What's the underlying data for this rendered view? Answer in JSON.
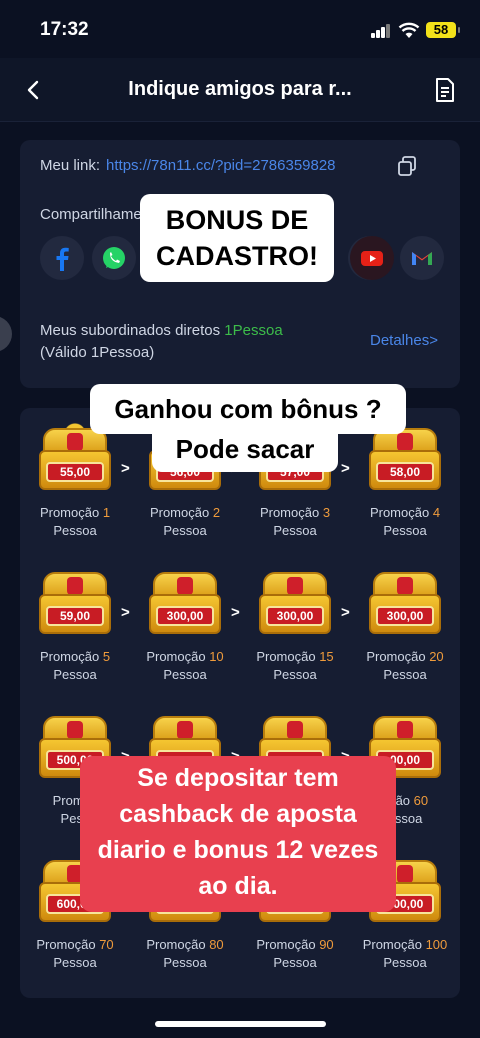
{
  "status_bar": {
    "time": "17:32",
    "battery": "58"
  },
  "header": {
    "title": "Indique amigos para r..."
  },
  "link_card": {
    "link_label": "Meu link:",
    "link_url": "https://78n11.cc/?pid=2786359828",
    "share_label": "Compartilhamento",
    "social": [
      "facebook",
      "whatsapp",
      "telegram",
      "instagram",
      "tiktok",
      "twitter",
      "youtube",
      "gmail"
    ],
    "subordinates_line1_prefix": "Meus subordinados diretos",
    "subordinates_count": "1Pessoa",
    "subordinates_line2": "(Válido 1Pessoa)",
    "details_link": "Detalhes>"
  },
  "tiers": [
    {
      "amount": "55,00",
      "promo": "Promoção",
      "n": "1",
      "unit": "Pessoa"
    },
    {
      "amount": "56,00",
      "promo": "Promoção",
      "n": "2",
      "unit": "Pessoa"
    },
    {
      "amount": "57,00",
      "promo": "Promoção",
      "n": "3",
      "unit": "Pessoa"
    },
    {
      "amount": "58,00",
      "promo": "Promoção",
      "n": "4",
      "unit": "Pessoa"
    },
    {
      "amount": "59,00",
      "promo": "Promoção",
      "n": "5",
      "unit": "Pessoa"
    },
    {
      "amount": "300,00",
      "promo": "Promoção",
      "n": "10",
      "unit": "Pessoa"
    },
    {
      "amount": "300,00",
      "promo": "Promoção",
      "n": "15",
      "unit": "Pessoa"
    },
    {
      "amount": "300,00",
      "promo": "Promoção",
      "n": "20",
      "unit": "Pessoa"
    },
    {
      "amount": "500,00",
      "promo": "Promoç",
      "n": "",
      "unit": "Pess"
    },
    {
      "amount": "",
      "promo": "",
      "n": "",
      "unit": ""
    },
    {
      "amount": "",
      "promo": "",
      "n": "",
      "unit": ""
    },
    {
      "amount": "00,00",
      "promo": "oção",
      "n": "60",
      "unit": "essoa"
    },
    {
      "amount": "600,00",
      "promo": "Promoção",
      "n": "70",
      "unit": "Pessoa"
    },
    {
      "amount": "600",
      "promo": "Promoção",
      "n": "80",
      "unit": "Pessoa"
    },
    {
      "amount": "0,00",
      "promo": "Promoção",
      "n": "90",
      "unit": "Pessoa"
    },
    {
      "amount": "700,00",
      "promo": "Promoção",
      "n": "100",
      "unit": "Pessoa"
    }
  ],
  "arrow": ">",
  "overlays": {
    "bonus_line1": "BONUS DE",
    "bonus_line2": "CADASTRO!",
    "ganhou_line1": "Ganhou com bônus ?",
    "ganhou_line2": "Pode sacar",
    "red_line1": "Se depositar tem",
    "red_line2": "cashback de aposta",
    "red_line3": "diario e bonus 12 vezes",
    "red_line4": "ao dia."
  }
}
